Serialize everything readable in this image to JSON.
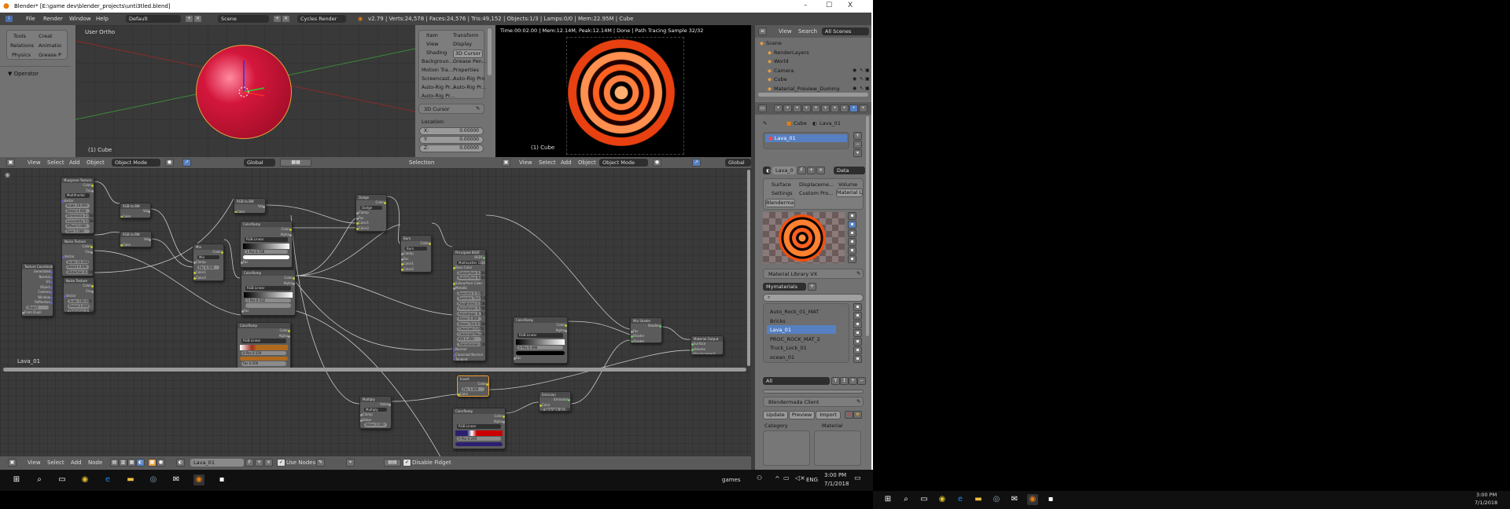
{
  "window": {
    "title": "Blender* [E:\\game dev\\blender_projects\\unti3tled.blend]",
    "minimize": "–",
    "maximize": "☐",
    "close": "X"
  },
  "info_header": {
    "menus": [
      "File",
      "Render",
      "Window",
      "Help"
    ],
    "layout": "Default",
    "scene": "Scene",
    "engine": "Cycles Render",
    "stats": "v2.79 | Verts:24,578 | Faces:24,576 | Tris:49,152 | Objects:1/3 | Lamps:0/0 | Mem:22.95M | Cube"
  },
  "tool_shelf": {
    "tabs": [
      [
        "Tools",
        "Creat"
      ],
      [
        "Relations",
        "Animatio"
      ],
      [
        "Physics",
        "Grease P"
      ]
    ],
    "operator": "▼ Operator"
  },
  "viewport3d": {
    "label": "User Ortho",
    "object": "(1) Cube",
    "sphere_color": "#d4173c"
  },
  "n_panel": {
    "tabs": [
      [
        "Item",
        "Transform"
      ],
      [
        "View",
        "Display"
      ],
      [
        "Shading",
        "3D Cursor"
      ],
      [
        "Backgroun...",
        "Grease Pen..."
      ],
      [
        "Motion Tra...",
        "Properties"
      ],
      [
        "Screencast...",
        "Auto-Rig Pro"
      ],
      [
        "Auto-Rig Pr...",
        "Auto-Rig Pr..."
      ],
      [
        "Auto-Rig Pr...",
        ""
      ]
    ],
    "cursor_panel": "3D Cursor",
    "location_label": "Location:",
    "x": {
      "label": "X:",
      "value": "0.00000"
    },
    "y": {
      "label": "Y:",
      "value": "0.00000"
    },
    "z": {
      "label": "Z:",
      "value": "0.00000"
    }
  },
  "view_header": {
    "menus": [
      "View",
      "Select",
      "Add",
      "Object"
    ],
    "mode": "Object Mode",
    "orientation": "Global",
    "status": "Selection"
  },
  "render_view": {
    "stats": "Time:00:02.00 | Mem:12.14M, Peak:12.14M | Done | Path Tracing Sample 32/32",
    "object": "(1) Cube"
  },
  "render_header": {
    "menus": [
      "View",
      "Select",
      "Add",
      "Object"
    ],
    "mode": "Object Mode",
    "orientation": "Global"
  },
  "outliner": {
    "menus": [
      "View",
      "Search"
    ],
    "filter": "All Scenes",
    "items": [
      {
        "label": "Scene",
        "level": 0
      },
      {
        "label": "RenderLayers",
        "level": 1
      },
      {
        "label": "World",
        "level": 1
      },
      {
        "label": "Camera",
        "level": 1
      },
      {
        "label": "Cube",
        "level": 1
      },
      {
        "label": "Material_Preview_Dummy",
        "level": 1
      }
    ]
  },
  "properties": {
    "breadcrumb": [
      "Cube",
      "Lava_01"
    ],
    "slot": "Lava_01",
    "material_name": "Lava_0",
    "fake_user": "F",
    "link": "Data",
    "tabs": [
      [
        "Surface",
        "Displaceme...",
        "Volume"
      ],
      [
        "Settings",
        "Custom Pro...",
        "Material Li..."
      ],
      [
        "Blenderma..."
      ]
    ],
    "mlvx": {
      "title": "Material Library VX",
      "library": "Mymaterials",
      "search": "",
      "materials": [
        "Auto_Rock_01_MAT",
        "Bricks",
        "Lava_01",
        "PROC_ROCK_MAT_2",
        "Truck_Lock_01",
        "ocean_01"
      ],
      "selected": 2,
      "filter": "All"
    },
    "blendermada": {
      "title": "Blendermada Client",
      "buttons": [
        "Update",
        "Preview",
        "Import"
      ],
      "category": "Category",
      "material": "Material"
    }
  },
  "node_editor": {
    "frame_label": "Lava_01",
    "nodes": [
      {
        "title": "Musgrave Texture",
        "rows": [
          [
            "Color",
            "out"
          ],
          [
            "Fac",
            "out"
          ],
          [
            "Multifractal",
            "select"
          ],
          [
            "Vector",
            "in"
          ],
          [
            "Scale 10.000",
            "field"
          ],
          [
            "Detail 4.000",
            "field"
          ],
          [
            "Dimension 2.000",
            "field"
          ],
          [
            "Lacunarity 2.000",
            "field"
          ],
          [
            "Offset 0.000",
            "field"
          ],
          [
            "Gain 1.000",
            "field"
          ]
        ]
      },
      {
        "title": "Noise Texture",
        "rows": [
          [
            "Color",
            "out"
          ],
          [
            "Fac",
            "out"
          ],
          [
            "Vector",
            "in"
          ],
          [
            "Scale 20.000",
            "field"
          ],
          [
            "Detail 4.000",
            "field"
          ],
          [
            "Distortion 0.000",
            "field"
          ]
        ]
      },
      {
        "title": "Noise Texture",
        "rows": [
          [
            "Color",
            "out"
          ],
          [
            "Fac",
            "out"
          ],
          [
            "Vector",
            "in"
          ],
          [
            "Scale 100.000",
            "field"
          ],
          [
            "Detail 2.000",
            "field"
          ],
          [
            "Distortion 0.000",
            "field"
          ]
        ]
      },
      {
        "title": "Texture Coordinate",
        "rows": [
          [
            "Generated",
            "out"
          ],
          [
            "Normal",
            "out"
          ],
          [
            "UV",
            "out"
          ],
          [
            "Object",
            "out"
          ],
          [
            "Camera",
            "out"
          ],
          [
            "Window",
            "out"
          ],
          [
            "Reflection",
            "out"
          ],
          [
            "Object:",
            "field"
          ],
          [
            "From Dupli",
            "in"
          ]
        ]
      },
      {
        "title": "RGB to BW",
        "rows": [
          [
            "Val",
            "out"
          ],
          [
            "Color",
            "in"
          ]
        ]
      },
      {
        "title": "RGB to BW",
        "rows": [
          [
            "Val",
            "out"
          ],
          [
            "Color",
            "in"
          ]
        ]
      },
      {
        "title": "Mix",
        "rows": [
          [
            "Color",
            "out"
          ],
          [
            "Mix",
            "select"
          ],
          [
            "Clamp",
            "in"
          ],
          [
            "Fac 0.500",
            "field"
          ],
          [
            "Color1",
            "in"
          ],
          [
            "Color2",
            "in"
          ]
        ]
      },
      {
        "title": "RGB to BW",
        "rows": [
          [
            "Val",
            "out"
          ],
          [
            "Color",
            "in"
          ]
        ]
      },
      {
        "title": "ColorRamp",
        "rows": [
          [
            "Color",
            "out"
          ],
          [
            "Alpha",
            "out"
          ],
          [
            "RGB  Linear",
            "select"
          ],
          [
            "",
            "ramp"
          ],
          [
            "1   Pos 0.728",
            "field"
          ],
          [
            "",
            "bar"
          ],
          [
            "Fac",
            "in"
          ]
        ]
      },
      {
        "title": "ColorRamp",
        "rows": [
          [
            "Color",
            "out"
          ],
          [
            "Alpha",
            "out"
          ],
          [
            "RGB  Linear",
            "select"
          ],
          [
            "",
            "ramp"
          ],
          [
            "1   Pos 0.532",
            "field"
          ],
          [
            "",
            "field"
          ],
          [
            "Fac",
            "in"
          ]
        ]
      },
      {
        "title": "Dodge",
        "rows": [
          [
            "Color",
            "out"
          ],
          [
            "Dodge",
            "select"
          ],
          [
            "Clamp",
            "in"
          ],
          [
            "Fac",
            "in"
          ],
          [
            "Color1",
            "in"
          ],
          [
            "Color2",
            "in"
          ]
        ]
      },
      {
        "title": "Burn",
        "rows": [
          [
            "Color",
            "out"
          ],
          [
            "Burn",
            "select"
          ],
          [
            "Clamp",
            "in"
          ],
          [
            "Fac",
            "in"
          ],
          [
            "Color1",
            "in"
          ],
          [
            "Color2",
            "in"
          ]
        ]
      },
      {
        "title": "Principled BSDF",
        "rows": [
          [
            "BSDF",
            "out"
          ],
          [
            "Multiscatter GGX",
            "select"
          ],
          [
            "Base Color",
            "in"
          ],
          [
            "Subsurface 0.000",
            "field"
          ],
          [
            "Subsurface Radius",
            "field"
          ],
          [
            "Subsurface Color",
            "in"
          ],
          [
            "Metallic",
            "in"
          ],
          [
            "Specular 0.500",
            "field"
          ],
          [
            "Specular Tint 0.000",
            "field"
          ],
          [
            "Roughness 0.500",
            "field"
          ],
          [
            "Anisotropic 0.000",
            "field"
          ],
          [
            "Anisotropic R. 0.000",
            "field"
          ],
          [
            "Sheen 0.000",
            "field"
          ],
          [
            "Sheen Tint 0.500",
            "field"
          ],
          [
            "Clearcoat 0.000",
            "field"
          ],
          [
            "Clearcoat Rou. 0.030",
            "field"
          ],
          [
            "IOR 1.450",
            "field"
          ],
          [
            "Transmission 0.000",
            "field"
          ],
          [
            "Normal",
            "in"
          ],
          [
            "Clearcoat Normal",
            "in"
          ],
          [
            "Tangent",
            "in"
          ]
        ]
      },
      {
        "title": "ColorRamp",
        "rows": [
          [
            "Color",
            "out"
          ],
          [
            "Alpha",
            "out"
          ],
          [
            "RGB  Linear",
            "select"
          ],
          [
            "",
            "ramp"
          ],
          [
            "0   Pos 0.486",
            "field"
          ],
          [
            "",
            "bar"
          ],
          [
            "Fac",
            "in"
          ]
        ]
      },
      {
        "title": "Mix Shader",
        "rows": [
          [
            "Shader",
            "out"
          ],
          [
            "Fac",
            "in"
          ],
          [
            "Shader",
            "in"
          ],
          [
            "Shader",
            "in"
          ]
        ]
      },
      {
        "title": "Material Output",
        "rows": [
          [
            "Surface",
            "in"
          ],
          [
            "Volume",
            "in"
          ],
          [
            "Displacement",
            "in"
          ]
        ]
      },
      {
        "title": "Invert",
        "rows": [
          [
            "Color",
            "out"
          ],
          [
            "Fac 1.000",
            "field"
          ],
          [
            "Color",
            "in"
          ]
        ]
      },
      {
        "title": "ColorRamp",
        "rows": [
          [
            "Color",
            "out"
          ],
          [
            "Alpha",
            "out"
          ],
          [
            "RGB  Linear",
            "select"
          ],
          [
            "",
            "ramp"
          ],
          [
            "0   Pos 0.159",
            "field"
          ],
          [
            "",
            "bar"
          ],
          [
            "Fac 0.500",
            "field"
          ]
        ]
      },
      {
        "title": "Multiply",
        "rows": [
          [
            "Value",
            "out"
          ],
          [
            "Multiply",
            "select"
          ],
          [
            "Clamp",
            "in"
          ],
          [
            "Value",
            "in"
          ],
          [
            "Value 2.000",
            "field"
          ]
        ]
      },
      {
        "title": "Emission",
        "rows": [
          [
            "Emission",
            "out"
          ],
          [
            "Color",
            "in"
          ],
          [
            "Strength 20.000",
            "field"
          ]
        ]
      },
      {
        "title": "ColorRamp",
        "rows": [
          [
            "Color",
            "out"
          ],
          [
            "Alpha",
            "out"
          ],
          [
            "RGB  Linear",
            "select"
          ],
          [
            "",
            "ramp"
          ],
          [
            "0   Pos 0.245",
            "field"
          ],
          [
            "",
            "bar"
          ]
        ]
      }
    ]
  },
  "node_header": {
    "menus": [
      "View",
      "Select",
      "Add",
      "Node"
    ],
    "material": "Lava_01",
    "fake_user": "F",
    "use_nodes": "Use Nodes",
    "disable_fidget": "Disable Fidget"
  },
  "taskbar": {
    "search_text": "games",
    "language": "ENG",
    "time": "3:00 PM",
    "date": "7/1/2018",
    "apps": [
      "start",
      "search",
      "task-view",
      "chrome",
      "edge",
      "file-explorer",
      "steam",
      "mail",
      "blender",
      "sticky-notes"
    ]
  },
  "taskbar2": {
    "time": "3:00 PM",
    "date": "7/1/2018"
  }
}
